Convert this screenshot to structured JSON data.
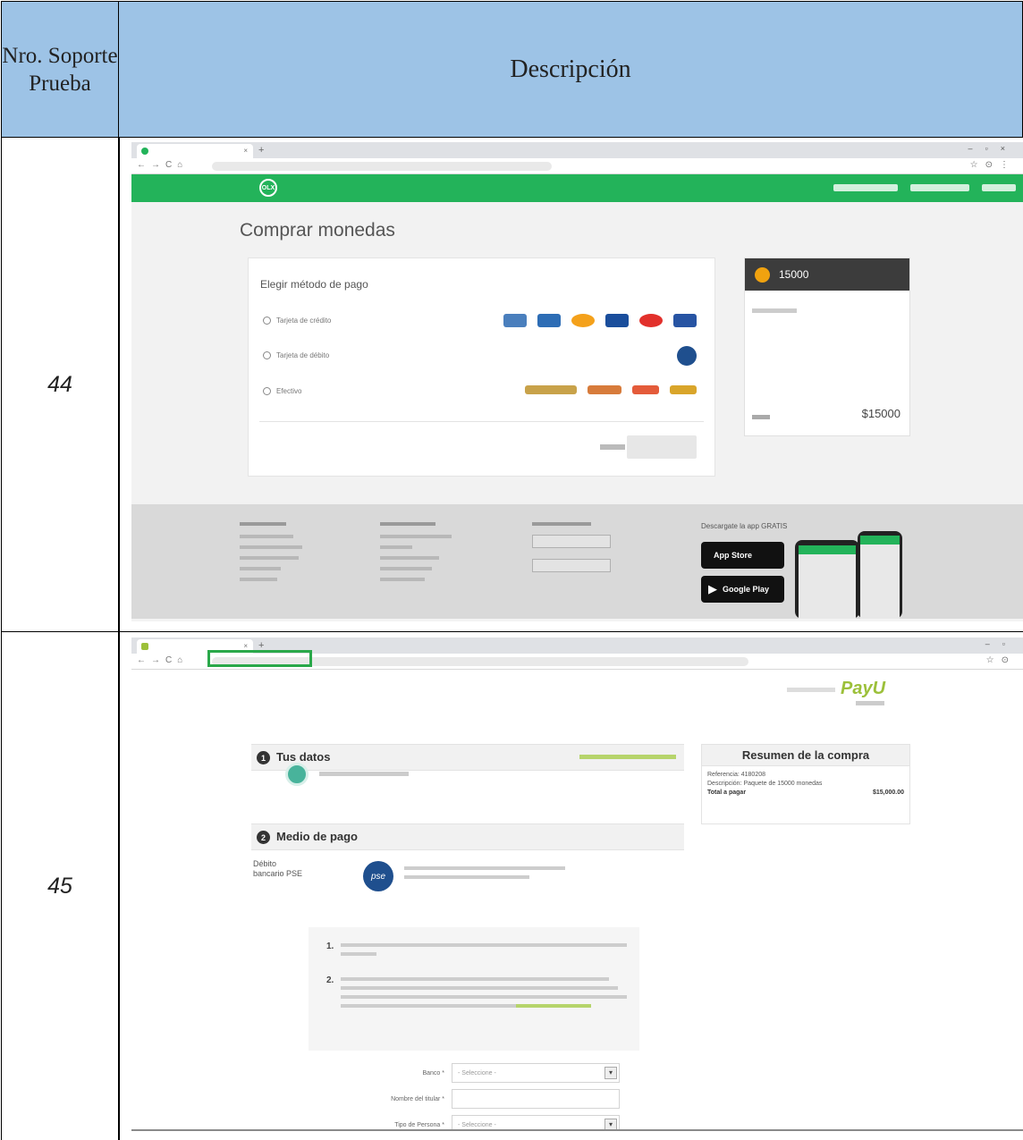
{
  "header": {
    "num_title": "Nro. Soporte Prueba",
    "desc_title": "Descripción"
  },
  "rows": [
    {
      "num": "44",
      "screenshot": {
        "browser_icons": [
          "tab-icon",
          "back-icon",
          "forward-icon",
          "reload-icon",
          "home-icon",
          "lock-icon"
        ],
        "page_title": "Comprar monedas",
        "payment_heading": "Elegir método de pago",
        "options": [
          "Tarjeta de crédito",
          "Tarjeta de débito",
          "Efectivo"
        ],
        "summary_amount": "15000",
        "summary_total": "$15000",
        "footer_heading_4": "Descargate la app GRATIS",
        "app_store": "App Store",
        "google_play": "Google Play"
      }
    },
    {
      "num": "45",
      "screenshot": {
        "brand": "PayU",
        "section_1": "Tus datos",
        "section_2": "Medio de pago",
        "summary_title": "Resumen de la compra",
        "summary_ref": "Referencia: 4180208",
        "summary_desc": "Descripción: Paquete de 15000 monedas",
        "summary_total_label": "Total a pagar",
        "summary_total_value": "$15,000.00",
        "method_label": "Débito bancario PSE",
        "pse_logo": "pse",
        "step_1": "1.",
        "step_2": "2.",
        "form_labels": [
          "Banco *",
          "Nombre del titular *",
          "Tipo de Persona *"
        ],
        "form_values": [
          "- Seleccione -",
          "",
          "- Seleccione -"
        ]
      }
    }
  ],
  "colors": {
    "header_bg": "#9dc3e6",
    "olx_green": "#23b35a",
    "payu_green": "#9cc03a",
    "highlight": "#2aa84a"
  }
}
